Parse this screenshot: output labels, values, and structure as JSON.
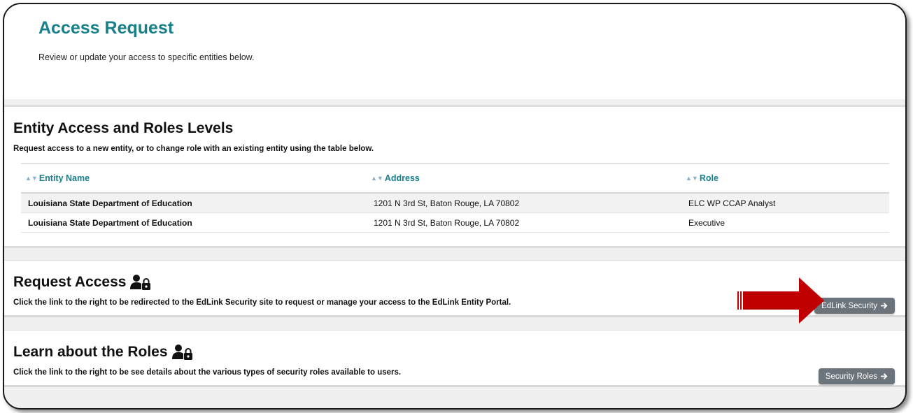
{
  "header": {
    "title": "Access Request",
    "subtitle": "Review or update your access to specific entities below."
  },
  "entity_section": {
    "title": "Entity Access and Roles Levels",
    "description": "Request access to a new entity, or to change role with an existing entity using the table below.",
    "columns": [
      "Entity Name",
      "Address",
      "Role"
    ],
    "rows": [
      {
        "entity": "Louisiana State Department of Education",
        "address": "1201 N 3rd St, Baton Rouge, LA 70802",
        "role": "ELC WP CCAP Analyst"
      },
      {
        "entity": "Louisiana State Department of Education",
        "address": "1201 N 3rd St, Baton Rouge, LA 70802",
        "role": "Executive"
      }
    ]
  },
  "request_section": {
    "title": "Request Access",
    "icon": "user-lock-icon",
    "description": "Click the link to the right to be redirected to the EdLink Security site to request or manage your access to the EdLink Entity Portal.",
    "button_label": "EdLink Security"
  },
  "learn_section": {
    "title": "Learn about the Roles",
    "icon": "user-lock-icon",
    "description": "Click the link to the right to be see details about the various types of security roles available to users.",
    "button_label": "Security Roles"
  },
  "colors": {
    "accent": "#17808a",
    "button": "#6b737b",
    "annotation_arrow": "#c00000"
  }
}
